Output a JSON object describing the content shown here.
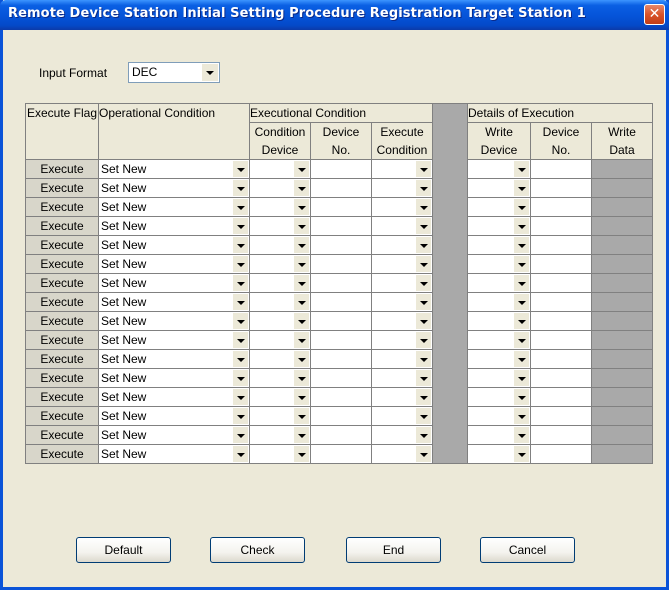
{
  "window": {
    "title": "Remote Device Station Initial Setting  Procedure Registration  Target Station 1"
  },
  "input_format": {
    "label": "Input Format",
    "value": "DEC"
  },
  "table": {
    "headers": {
      "execute_flag": "Execute Flag",
      "operational_condition": "Operational Condition",
      "executional_condition": "Executional Condition",
      "condition_device_line1": "Condition",
      "condition_device_line2": "Device",
      "device_no_line1": "Device",
      "device_no_line2": "No.",
      "execute_condition_line1": "Execute",
      "execute_condition_line2": "Condition",
      "details_of_execution": "Details of Execution",
      "write_device_line1": "Write",
      "write_device_line2": "Device",
      "write_device_no_line1": "Device",
      "write_device_no_line2": "No.",
      "write_data_line1": "Write",
      "write_data_line2": "Data"
    },
    "rows": [
      {
        "execute": "Execute",
        "op": "Set New"
      },
      {
        "execute": "Execute",
        "op": "Set New"
      },
      {
        "execute": "Execute",
        "op": "Set New"
      },
      {
        "execute": "Execute",
        "op": "Set New"
      },
      {
        "execute": "Execute",
        "op": "Set New"
      },
      {
        "execute": "Execute",
        "op": "Set New"
      },
      {
        "execute": "Execute",
        "op": "Set New"
      },
      {
        "execute": "Execute",
        "op": "Set New"
      },
      {
        "execute": "Execute",
        "op": "Set New"
      },
      {
        "execute": "Execute",
        "op": "Set New"
      },
      {
        "execute": "Execute",
        "op": "Set New"
      },
      {
        "execute": "Execute",
        "op": "Set New"
      },
      {
        "execute": "Execute",
        "op": "Set New"
      },
      {
        "execute": "Execute",
        "op": "Set New"
      },
      {
        "execute": "Execute",
        "op": "Set New"
      },
      {
        "execute": "Execute",
        "op": "Set New"
      }
    ]
  },
  "buttons": {
    "default": "Default",
    "check": "Check",
    "end": "End",
    "cancel": "Cancel"
  },
  "icons": {
    "close": "close-icon",
    "dropdown": "dropdown-arrow-icon"
  }
}
